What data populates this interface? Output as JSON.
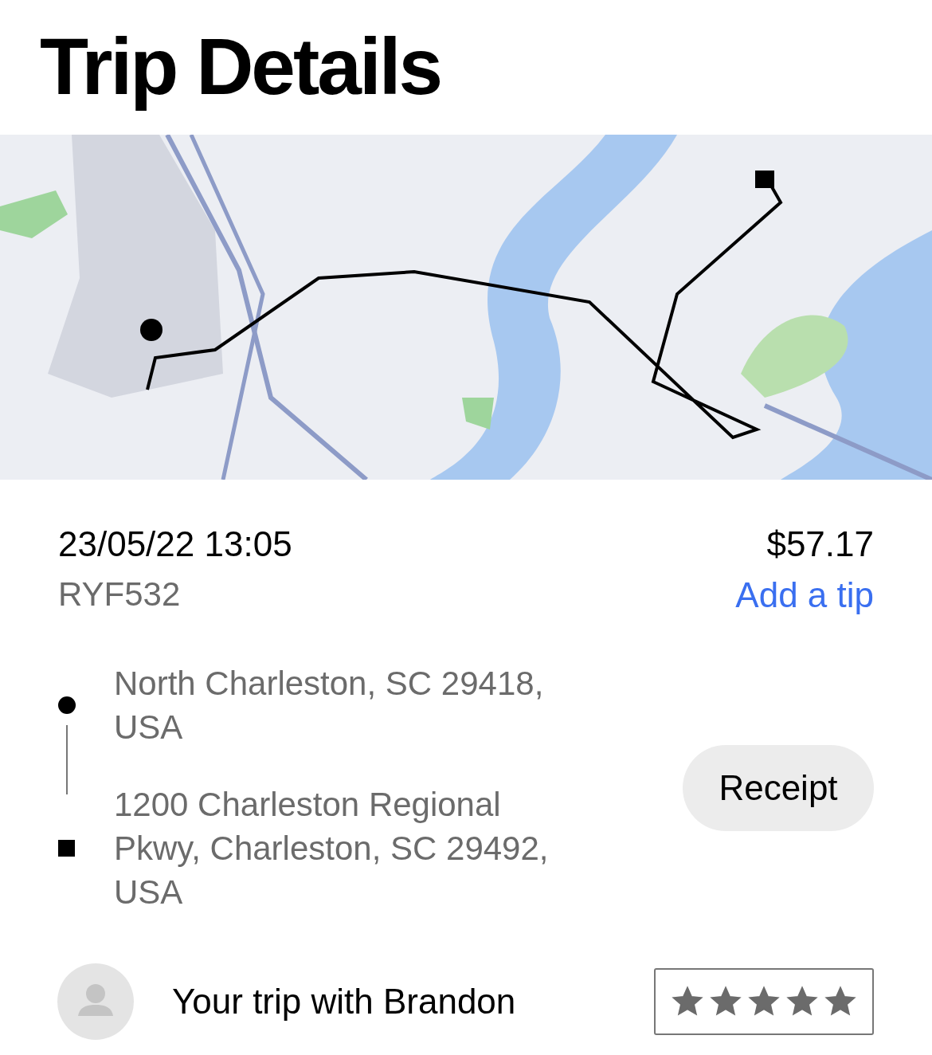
{
  "title": "Trip Details",
  "trip": {
    "datetime": "23/05/22 13:05",
    "plate": "RYF532",
    "fare": "$57.17",
    "tip_link": "Add a tip"
  },
  "route": [
    {
      "kind": "pickup",
      "address": "North Charleston, SC 29418, USA"
    },
    {
      "kind": "dropoff",
      "address": "1200 Charleston Regional Pkwy, Charleston, SC 29492, USA"
    }
  ],
  "receipt_button": "Receipt",
  "driver": {
    "text": "Your trip with Brandon",
    "stars": 5
  }
}
